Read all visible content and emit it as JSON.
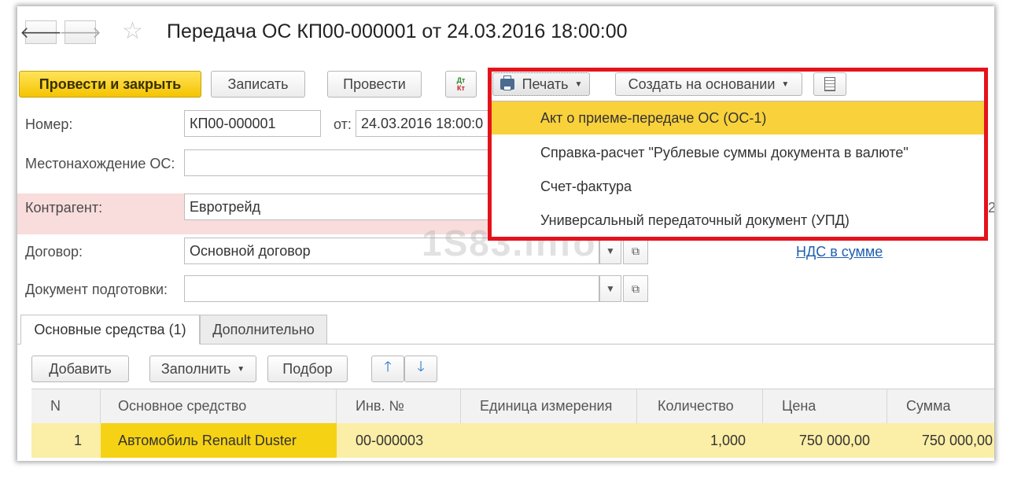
{
  "window": {
    "title": "Передача ОС КП00-000001 от 24.03.2016 18:00:00"
  },
  "toolbar": {
    "post_close": "Провести и закрыть",
    "save": "Записать",
    "post": "Провести",
    "dt_kt_top": "Дт",
    "dt_kt_bottom": "Кт",
    "print": "Печать",
    "create_based": "Создать на основании"
  },
  "form": {
    "number_label": "Номер:",
    "number_value": "КП00-000001",
    "date_label": "от:",
    "date_value": "24.03.2016 18:00:0",
    "location_label": "Местонахождение ОС:",
    "location_value": "",
    "counterparty_label": "Контрагент:",
    "counterparty_value": "Евротрейд",
    "contract_label": "Договор:",
    "contract_value": "Основной договор",
    "prep_doc_label": "Документ подготовки:",
    "prep_doc_value": "",
    "vat_link": "НДС в сумме",
    "edge_digit": "2"
  },
  "tabs": [
    {
      "label": "Основные средства (1)"
    },
    {
      "label": "Дополнительно"
    }
  ],
  "table_toolbar": {
    "add": "Добавить",
    "fill": "Заполнить",
    "select": "Подбор"
  },
  "table": {
    "columns": [
      "N",
      "Основное средство",
      "Инв. №",
      "Единица измерения",
      "Количество",
      "Цена",
      "Сумма"
    ],
    "rows": [
      [
        "1",
        "Автомобиль Renault Duster",
        "00-000003",
        "",
        "1,000",
        "750 000,00",
        "750 000,00"
      ]
    ]
  },
  "print_menu": {
    "items": [
      "Акт о приеме-передаче ОС (ОС-1)",
      "Справка-расчет \"Рублевые суммы документа в валюте\"",
      "Счет-фактура",
      "Универсальный передаточный документ (УПД)"
    ]
  },
  "watermark": "1S83.info",
  "colors": {
    "primary_button": "#f5c400",
    "highlight": "#f9d13b",
    "error_row": "#f9dcdc",
    "annotation_red": "#e4131b",
    "link": "#2060b0"
  }
}
